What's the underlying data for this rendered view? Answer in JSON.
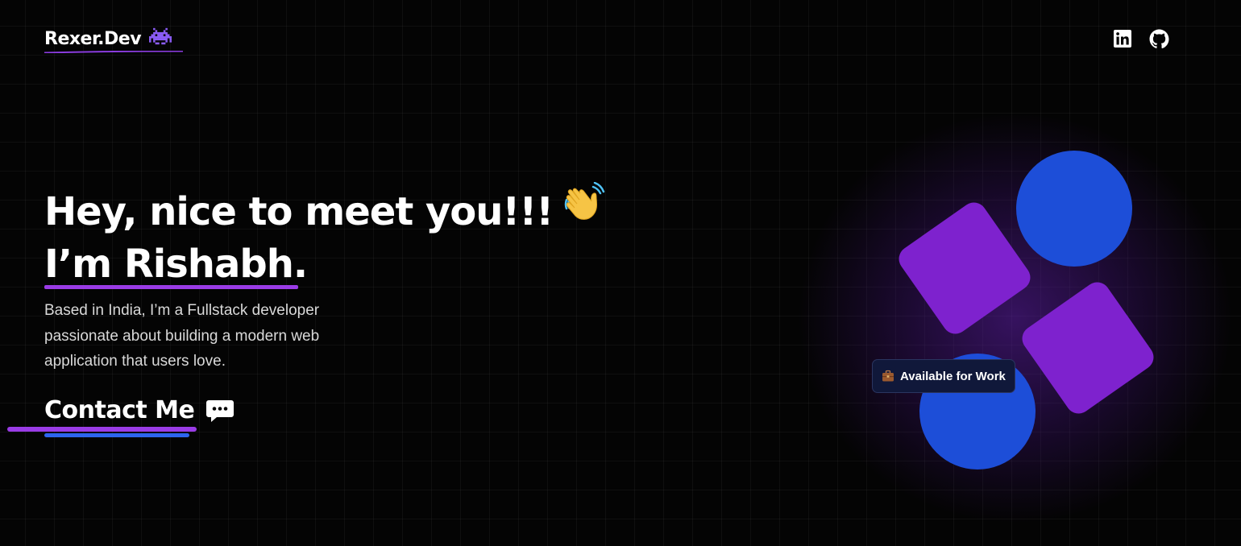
{
  "header": {
    "logo_text": "Rexer.Dev",
    "logo_icon": "space-invader-icon",
    "social": [
      {
        "name": "linkedin-icon"
      },
      {
        "name": "github-icon"
      }
    ]
  },
  "hero": {
    "title_line1": "Hey, nice to meet you!!!",
    "title_icon": "waving-hand-icon",
    "title_line2": "I’m Rishabh.",
    "description": "Based in India, I’m a Fullstack developer passionate about building a modern web application that users love.",
    "contact_label": "Contact Me",
    "contact_icon": "chat-bubble-icon"
  },
  "art": {
    "badge_icon": "briefcase-icon",
    "badge_label": "Available for Work"
  },
  "colors": {
    "background": "#040404",
    "accent_purple": "#9a3ce6",
    "accent_blue": "#2d64ee",
    "shape_purple": "#7e22ce",
    "shape_blue": "#1d4ed8",
    "badge_bg": "#10183a"
  }
}
